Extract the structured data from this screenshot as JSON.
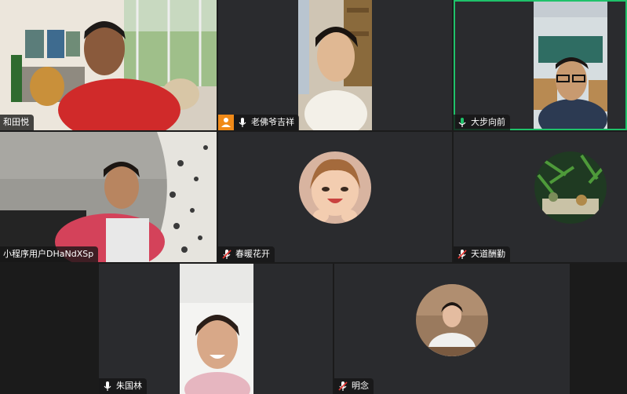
{
  "participants": [
    {
      "name": "和田悦",
      "mic": "none"
    },
    {
      "name": "老佛爷吉祥",
      "mic": "on",
      "host_badge": true
    },
    {
      "name": "大步向前",
      "mic": "on-active",
      "active_speaker": true
    },
    {
      "name": "小程序用户DHaNdXSp",
      "mic": "none"
    },
    {
      "name": "春暖花开",
      "mic": "muted"
    },
    {
      "name": "天道酬勤",
      "mic": "muted"
    },
    {
      "name": "朱国林",
      "mic": "on"
    },
    {
      "name": "明念",
      "mic": "muted"
    }
  ],
  "colors": {
    "tile_bg": "#2a2b2e",
    "active_border": "#1fc26a",
    "host_badge": "#f08a18",
    "muted_red": "#e53935"
  }
}
